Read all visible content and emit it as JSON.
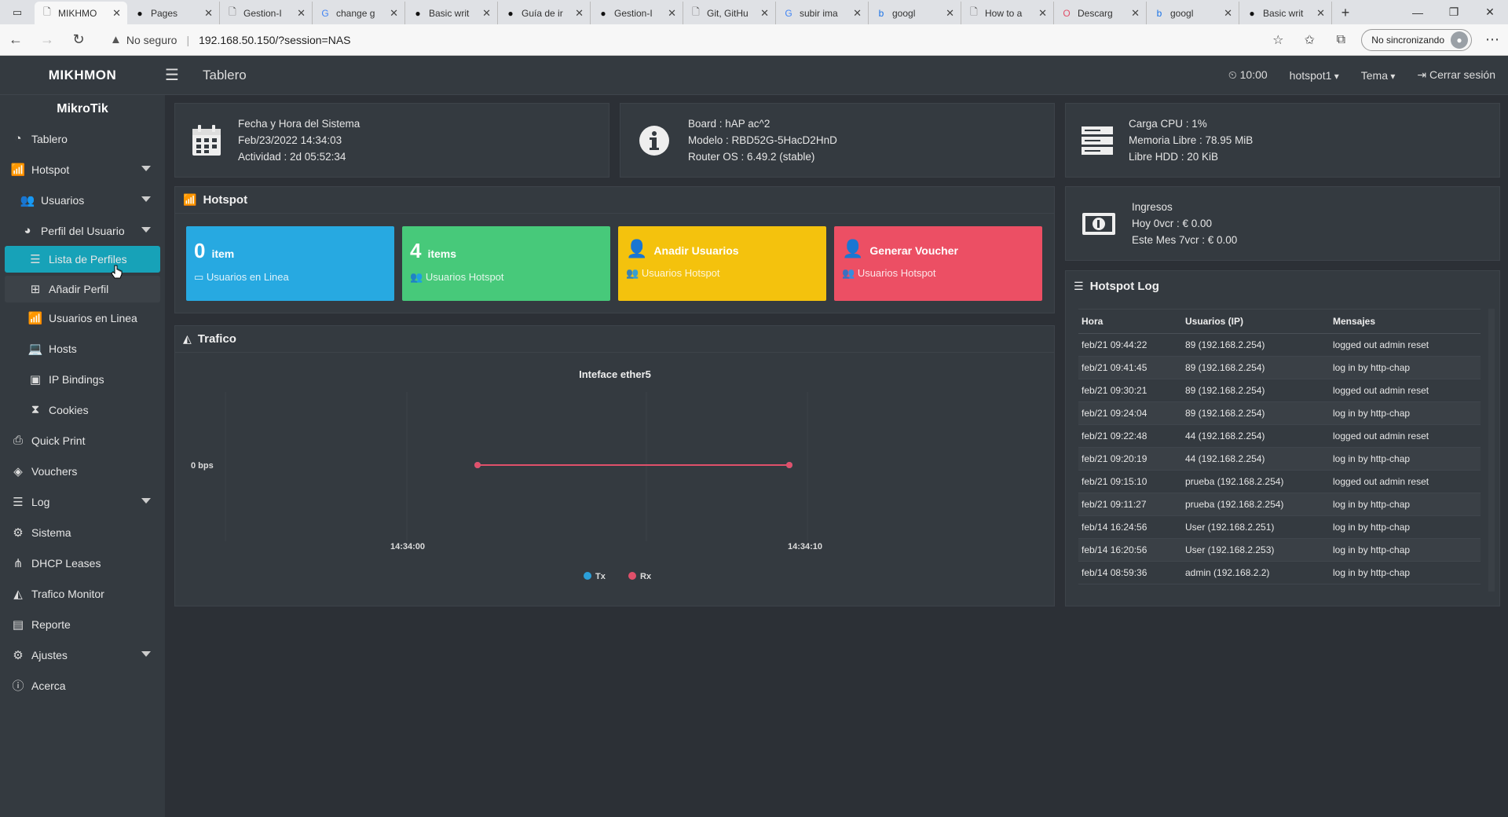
{
  "browser": {
    "tabs": [
      {
        "title": "MIKHMO",
        "icon": "page-icon",
        "active": true
      },
      {
        "title": "Pages",
        "icon": "github-icon"
      },
      {
        "title": "Gestion-I",
        "icon": "page-icon"
      },
      {
        "title": "change g",
        "icon": "google-icon"
      },
      {
        "title": "Basic writ",
        "icon": "github-icon"
      },
      {
        "title": "Guía de ir",
        "icon": "github-icon"
      },
      {
        "title": "Gestion-I",
        "icon": "github-icon"
      },
      {
        "title": "Git, GitHu",
        "icon": "page-icon"
      },
      {
        "title": "subir ima",
        "icon": "google-icon"
      },
      {
        "title": "googl",
        "icon": "bing-icon"
      },
      {
        "title": "How to a",
        "icon": "page-icon"
      },
      {
        "title": "Descarg",
        "icon": "opera-icon"
      },
      {
        "title": "googl",
        "icon": "bing-icon"
      },
      {
        "title": "Basic writ",
        "icon": "github-icon"
      }
    ],
    "address": {
      "security_label": "No seguro",
      "url": "192.168.50.150/?session=NAS"
    },
    "sync_label": "No sincronizando"
  },
  "app": {
    "brand": "MIKHMON",
    "page_title": "Tablero",
    "clock": "10:00",
    "hotspot_select": "hotspot1",
    "theme_label": "Tema",
    "logout_label": "Cerrar sesión"
  },
  "sidebar": {
    "title": "MikroTik",
    "items": [
      {
        "label": "Tablero",
        "icon": "dashboard-icon"
      },
      {
        "label": "Hotspot",
        "icon": "wifi-icon",
        "caret": true
      },
      {
        "label": "Usuarios",
        "icon": "users-icon",
        "caret": true
      },
      {
        "label": "Perfil del Usuario",
        "icon": "pie-chart-icon",
        "caret": true
      },
      {
        "label": "Lista de Perfiles",
        "icon": "list-icon"
      },
      {
        "label": "Añadir Perfil",
        "icon": "plus-square-icon"
      },
      {
        "label": "Usuarios en Linea",
        "icon": "wifi-icon"
      },
      {
        "label": "Hosts",
        "icon": "laptop-icon"
      },
      {
        "label": "IP Bindings",
        "icon": "address-book-icon"
      },
      {
        "label": "Cookies",
        "icon": "hourglass-icon"
      },
      {
        "label": "Quick Print",
        "icon": "print-icon"
      },
      {
        "label": "Vouchers",
        "icon": "ticket-icon"
      },
      {
        "label": "Log",
        "icon": "list-icon",
        "caret": true
      },
      {
        "label": "Sistema",
        "icon": "gear-icon"
      },
      {
        "label": "DHCP Leases",
        "icon": "sitemap-icon"
      },
      {
        "label": "Trafico Monitor",
        "icon": "area-chart-icon"
      },
      {
        "label": "Reporte",
        "icon": "money-icon"
      },
      {
        "label": "Ajustes",
        "icon": "gears-icon",
        "caret": true
      },
      {
        "label": "Acerca",
        "icon": "info-icon"
      }
    ]
  },
  "info": {
    "system": {
      "title": "Fecha y Hora del Sistema",
      "date": "Feb/23/2022 14:34:03",
      "uptime": "Actividad : 2d 05:52:34",
      "icon": "calendar-icon"
    },
    "board": {
      "board": "Board : hAP ac^2",
      "model": "Modelo : RBD52G-5HacD2HnD",
      "os": "Router OS : 6.49.2 (stable)",
      "icon": "info-circle-icon"
    },
    "resources": {
      "cpu": "Carga CPU : 1%",
      "memory": "Memoria Libre : 78.95 MiB",
      "hdd": "Libre HDD : 20 KiB",
      "icon": "server-icon"
    },
    "income": {
      "title": "Ingresos",
      "today": "Hoy 0vcr : € 0.00",
      "month": "Este Mes 7vcr : € 0.00",
      "icon": "money-icon"
    }
  },
  "hotspot": {
    "title": "Hotspot",
    "tiles": [
      {
        "num": "0",
        "label": "item",
        "sub": "Usuarios en Linea",
        "color": "#27a9e1"
      },
      {
        "num": "4",
        "label": "items",
        "sub": "Usuarios Hotspot",
        "color": "#47c97a"
      },
      {
        "num": "",
        "label": "Anadir Usuarios",
        "sub": "Usuarios Hotspot",
        "color": "#f4c20d"
      },
      {
        "num": "",
        "label": "Generar Voucher",
        "sub": "Usuarios Hotspot",
        "color": "#ec4f64"
      }
    ]
  },
  "trafico": {
    "title": "Trafico"
  },
  "chart_data": {
    "type": "line",
    "title": "Inteface ether5",
    "x": [
      "14:34:00",
      "14:34:10"
    ],
    "ylabel_tick": "0 bps",
    "series": [
      {
        "name": "Tx",
        "color": "#2b9fd9",
        "values": [
          0,
          0
        ]
      },
      {
        "name": "Rx",
        "color": "#e0506a",
        "values": [
          0,
          0
        ]
      }
    ]
  },
  "hotspot_log": {
    "title": "Hotspot Log",
    "headers": [
      "Hora",
      "Usuarios (IP)",
      "Mensajes"
    ],
    "rows": [
      [
        "feb/21 09:44:22",
        "89 (192.168.2.254)",
        "logged out admin reset"
      ],
      [
        "feb/21 09:41:45",
        "89 (192.168.2.254)",
        "log in by http-chap"
      ],
      [
        "feb/21 09:30:21",
        "89 (192.168.2.254)",
        "logged out admin reset"
      ],
      [
        "feb/21 09:24:04",
        "89 (192.168.2.254)",
        "log in by http-chap"
      ],
      [
        "feb/21 09:22:48",
        "44 (192.168.2.254)",
        "logged out admin reset"
      ],
      [
        "feb/21 09:20:19",
        "44 (192.168.2.254)",
        "log in by http-chap"
      ],
      [
        "feb/21 09:15:10",
        "prueba (192.168.2.254)",
        "logged out admin reset"
      ],
      [
        "feb/21 09:11:27",
        "prueba (192.168.2.254)",
        "log in by http-chap"
      ],
      [
        "feb/14 16:24:56",
        "User (192.168.2.251)",
        "log in by http-chap"
      ],
      [
        "feb/14 16:20:56",
        "User (192.168.2.253)",
        "log in by http-chap"
      ],
      [
        "feb/14 08:59:36",
        "admin (192.168.2.2)",
        "log in by http-chap"
      ]
    ]
  }
}
